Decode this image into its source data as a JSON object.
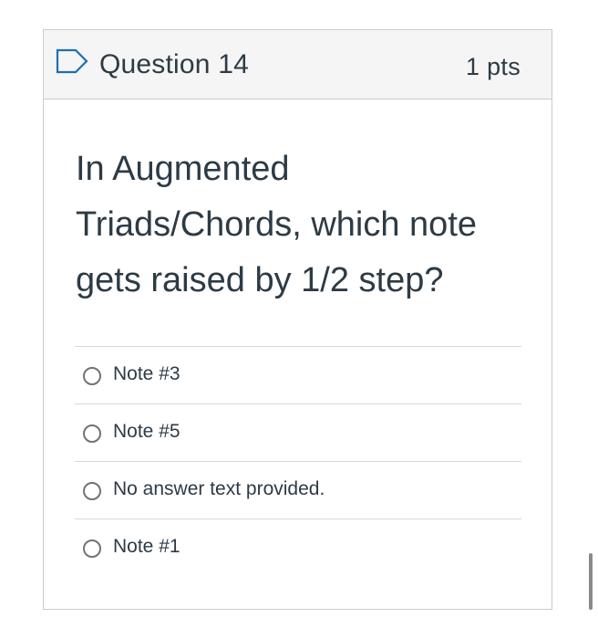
{
  "question": {
    "title": "Question 14",
    "points": "1 pts",
    "flag_icon": "flag-outline-icon",
    "text": "In Augmented Triads/Chords, which note gets raised by 1/2 step?"
  },
  "answers": [
    {
      "label": "Note #3",
      "selected": false
    },
    {
      "label": "Note #5",
      "selected": false
    },
    {
      "label": "No answer text provided.",
      "selected": false
    },
    {
      "label": "Note #1",
      "selected": false
    }
  ],
  "colors": {
    "header_bg": "#f5f5f5",
    "border": "#c7cdd1",
    "flag_outline": "#1d6fb8",
    "text": "#2d3b45"
  }
}
